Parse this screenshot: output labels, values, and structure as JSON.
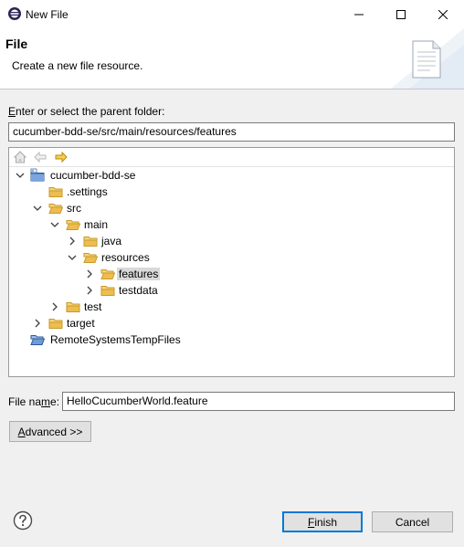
{
  "window": {
    "title": "New File",
    "minimize_glyph": "—",
    "maximize_glyph": "☐",
    "close_glyph": "✕"
  },
  "header": {
    "title": "File",
    "description": "Create a new file resource."
  },
  "parent_folder": {
    "label_accel": "E",
    "label_rest": "nter or select the parent folder:",
    "value": "cucumber-bdd-se/src/main/resources/features"
  },
  "tree": {
    "items": [
      {
        "label": "cucumber-bdd-se",
        "icon": "project-icon"
      },
      {
        "label": ".settings",
        "icon": "folder-icon"
      },
      {
        "label": "src",
        "icon": "folder-open-icon"
      },
      {
        "label": "main",
        "icon": "folder-open-icon"
      },
      {
        "label": "java",
        "icon": "folder-icon"
      },
      {
        "label": "resources",
        "icon": "folder-open-icon"
      },
      {
        "label": "features",
        "icon": "folder-open-icon"
      },
      {
        "label": "testdata",
        "icon": "folder-icon"
      },
      {
        "label": "test",
        "icon": "folder-icon"
      },
      {
        "label": "target",
        "icon": "folder-icon"
      },
      {
        "label": "RemoteSystemsTempFiles",
        "icon": "project-folder-icon"
      }
    ]
  },
  "file_name": {
    "label_pre": "File na",
    "label_accel": "m",
    "label_post": "e:",
    "value": "HelloCucumberWorld.feature"
  },
  "advanced_button": {
    "accel": "A",
    "rest": "dvanced >>"
  },
  "finish_button": {
    "accel": "F",
    "rest": "inish"
  },
  "cancel_button": {
    "label": "Cancel"
  },
  "colors": {
    "folder": "#e8b84a",
    "selection": "#d9d9d9",
    "accent": "#0078d7"
  }
}
